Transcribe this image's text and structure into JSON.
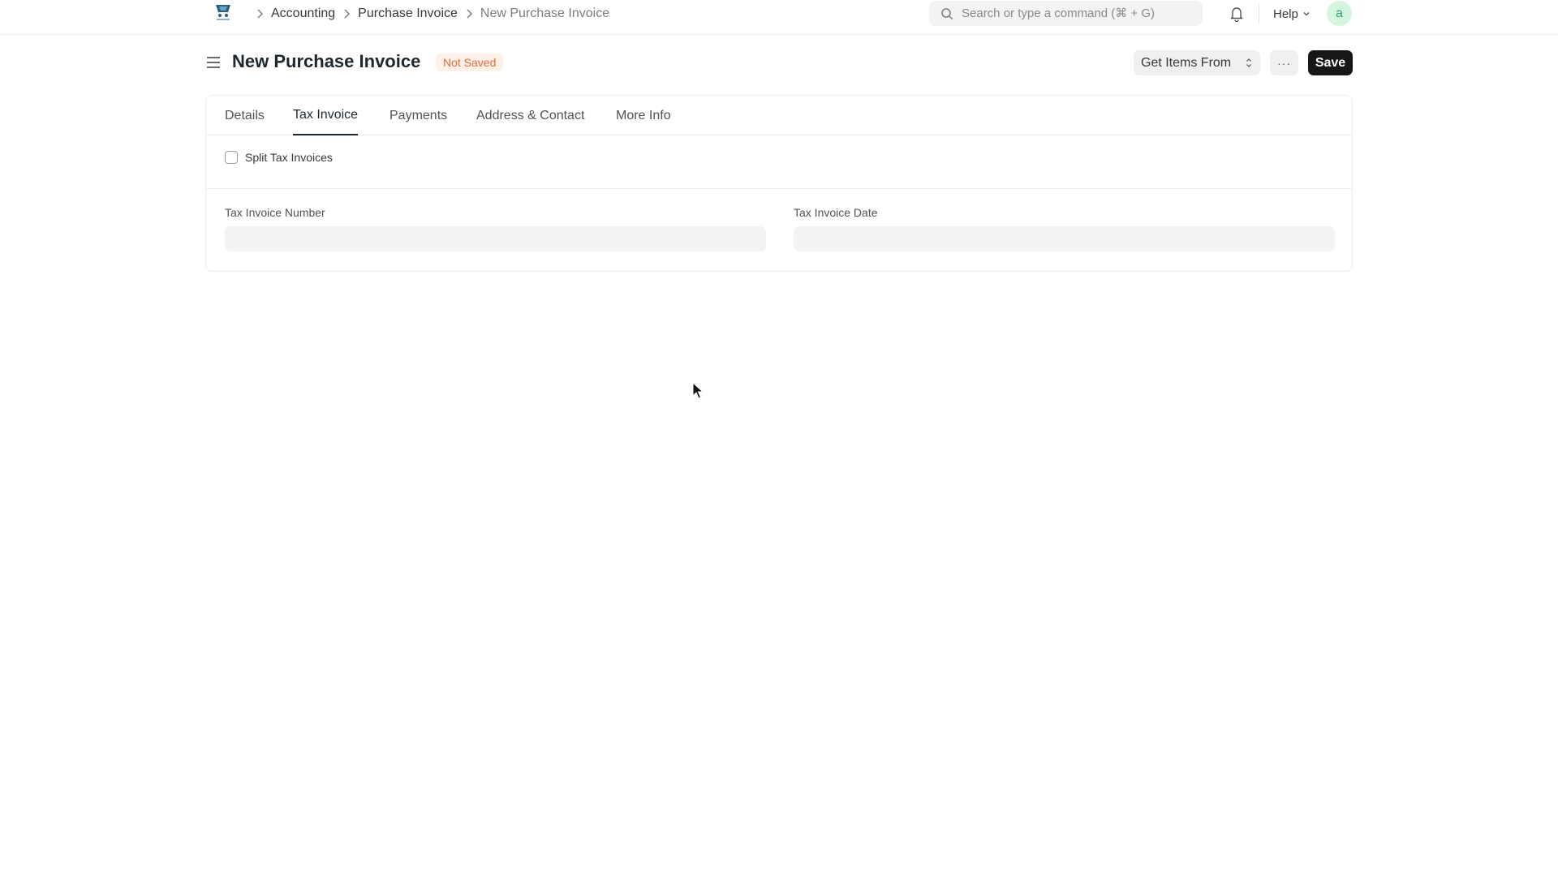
{
  "navbar": {
    "breadcrumbs": [
      "Accounting",
      "Purchase Invoice",
      "New Purchase Invoice"
    ],
    "search_placeholder": "Search or type a command (⌘ + G)",
    "help_label": "Help",
    "avatar_initial": "a"
  },
  "page": {
    "title": "New Purchase Invoice",
    "status": "Not Saved",
    "get_items_label": "Get Items From",
    "more_label": "···",
    "save_label": "Save"
  },
  "tabs": [
    "Details",
    "Tax Invoice",
    "Payments",
    "Address & Contact",
    "More Info"
  ],
  "active_tab": "Tax Invoice",
  "form": {
    "split_label": "Split Tax Invoices",
    "split_checked": false,
    "tax_invoice_number_label": "Tax Invoice Number",
    "tax_invoice_number_value": "",
    "tax_invoice_date_label": "Tax Invoice Date",
    "tax_invoice_date_value": ""
  },
  "colors": {
    "status_badge_bg": "#fff0e8",
    "status_badge_text": "#e06b3c",
    "save_button_bg": "#171717",
    "avatar_bg": "#d6f5e1",
    "avatar_text": "#30a66d"
  },
  "icons": [
    "app-logo-icon",
    "chevron-right-icon",
    "search-icon",
    "bell-icon",
    "chevron-down-icon",
    "menu-icon",
    "updown-icon",
    "cursor-icon"
  ]
}
